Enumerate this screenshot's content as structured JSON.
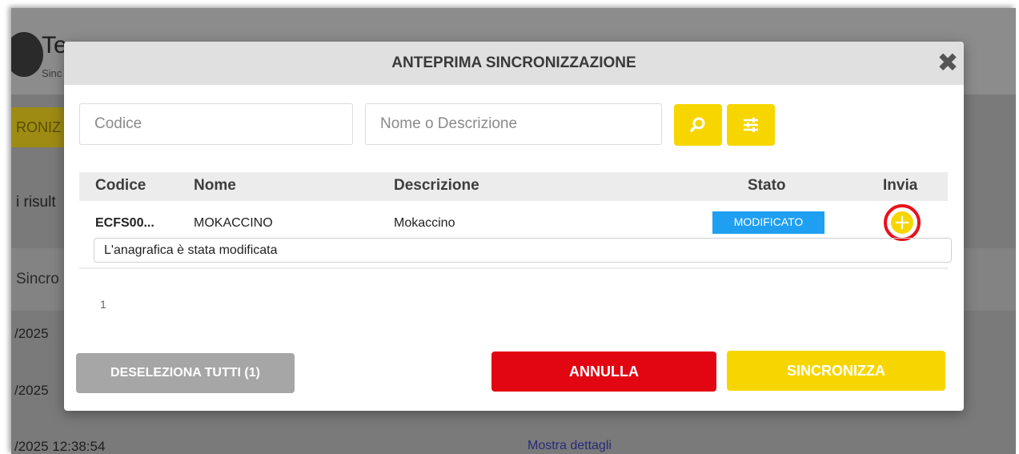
{
  "background": {
    "title": "Te",
    "subtitle": "Sinc",
    "sync_button": "RONIZ",
    "results_text": "i risult",
    "table_header": "Sincro",
    "rows": [
      "/2025",
      "/2025",
      "/2025 12:38:54"
    ],
    "details_link": "Mostra dettagli"
  },
  "modal": {
    "title": "ANTEPRIMA SINCRONIZZAZIONE",
    "close_icon": "✖",
    "search": {
      "code_placeholder": "Codice",
      "name_placeholder": "Nome o Descrizione"
    },
    "table": {
      "headers": {
        "code": "Codice",
        "name": "Nome",
        "description": "Descrizione",
        "status": "Stato",
        "send": "Invia"
      },
      "rows": [
        {
          "code": "ECFS00...",
          "name": "MOKACCINO",
          "description": "Mokaccino",
          "status": "MODIFICATO",
          "note": "L'anagrafica è stata modificata"
        }
      ]
    },
    "pagination": {
      "page": "1"
    },
    "buttons": {
      "deselect_all": "DESELEZIONA TUTTI (1)",
      "cancel": "ANNULLA",
      "sync": "SINCRONIZZA"
    }
  },
  "colors": {
    "accent_yellow": "#f7d600",
    "danger_red": "#e20613",
    "status_blue": "#1e9ff2",
    "highlight_red": "#e8121c"
  },
  "icons": {
    "search": "search-icon",
    "filter": "sliders-icon",
    "add": "plus-circle-icon",
    "close": "close-icon"
  }
}
